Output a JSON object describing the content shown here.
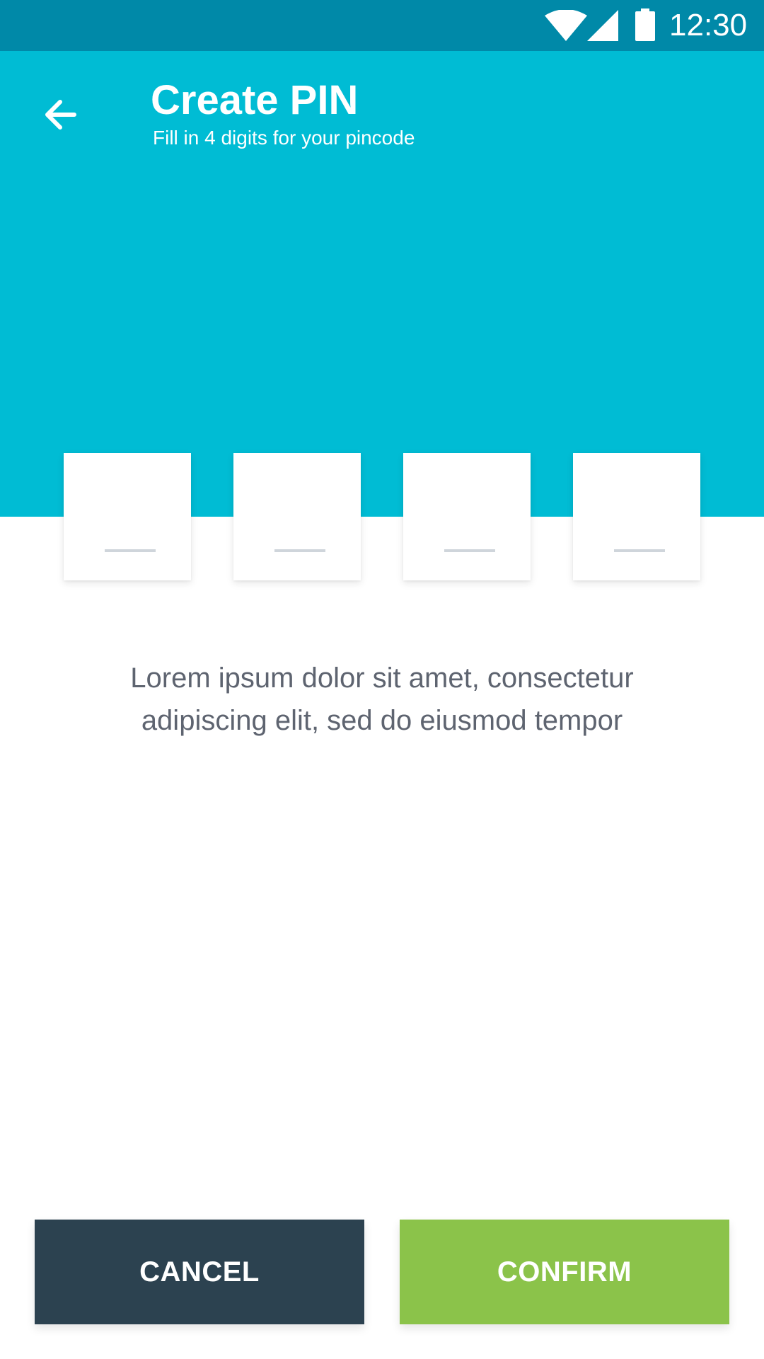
{
  "status_bar": {
    "time": "12:30",
    "icons": [
      "wifi-icon",
      "signal-icon",
      "battery-icon"
    ]
  },
  "header": {
    "back_icon": "arrow-left-icon",
    "title": "Create PIN",
    "subtitle": "Fill in 4 digits for your pincode"
  },
  "pin": {
    "digits": [
      "",
      "",
      "",
      ""
    ],
    "placeholder": "—"
  },
  "description": "Lorem ipsum dolor sit amet, consectetur adipiscing elit, sed do eiusmod tempor",
  "buttons": {
    "cancel_label": "CANCEL",
    "confirm_label": "CONFIRM"
  },
  "colors": {
    "status_bar": "#0089a8",
    "header": "#00bcd4",
    "cancel": "#2c4250",
    "confirm": "#8bc34a",
    "text_secondary": "#5e6470",
    "pin_underline": "#cfd5db"
  }
}
